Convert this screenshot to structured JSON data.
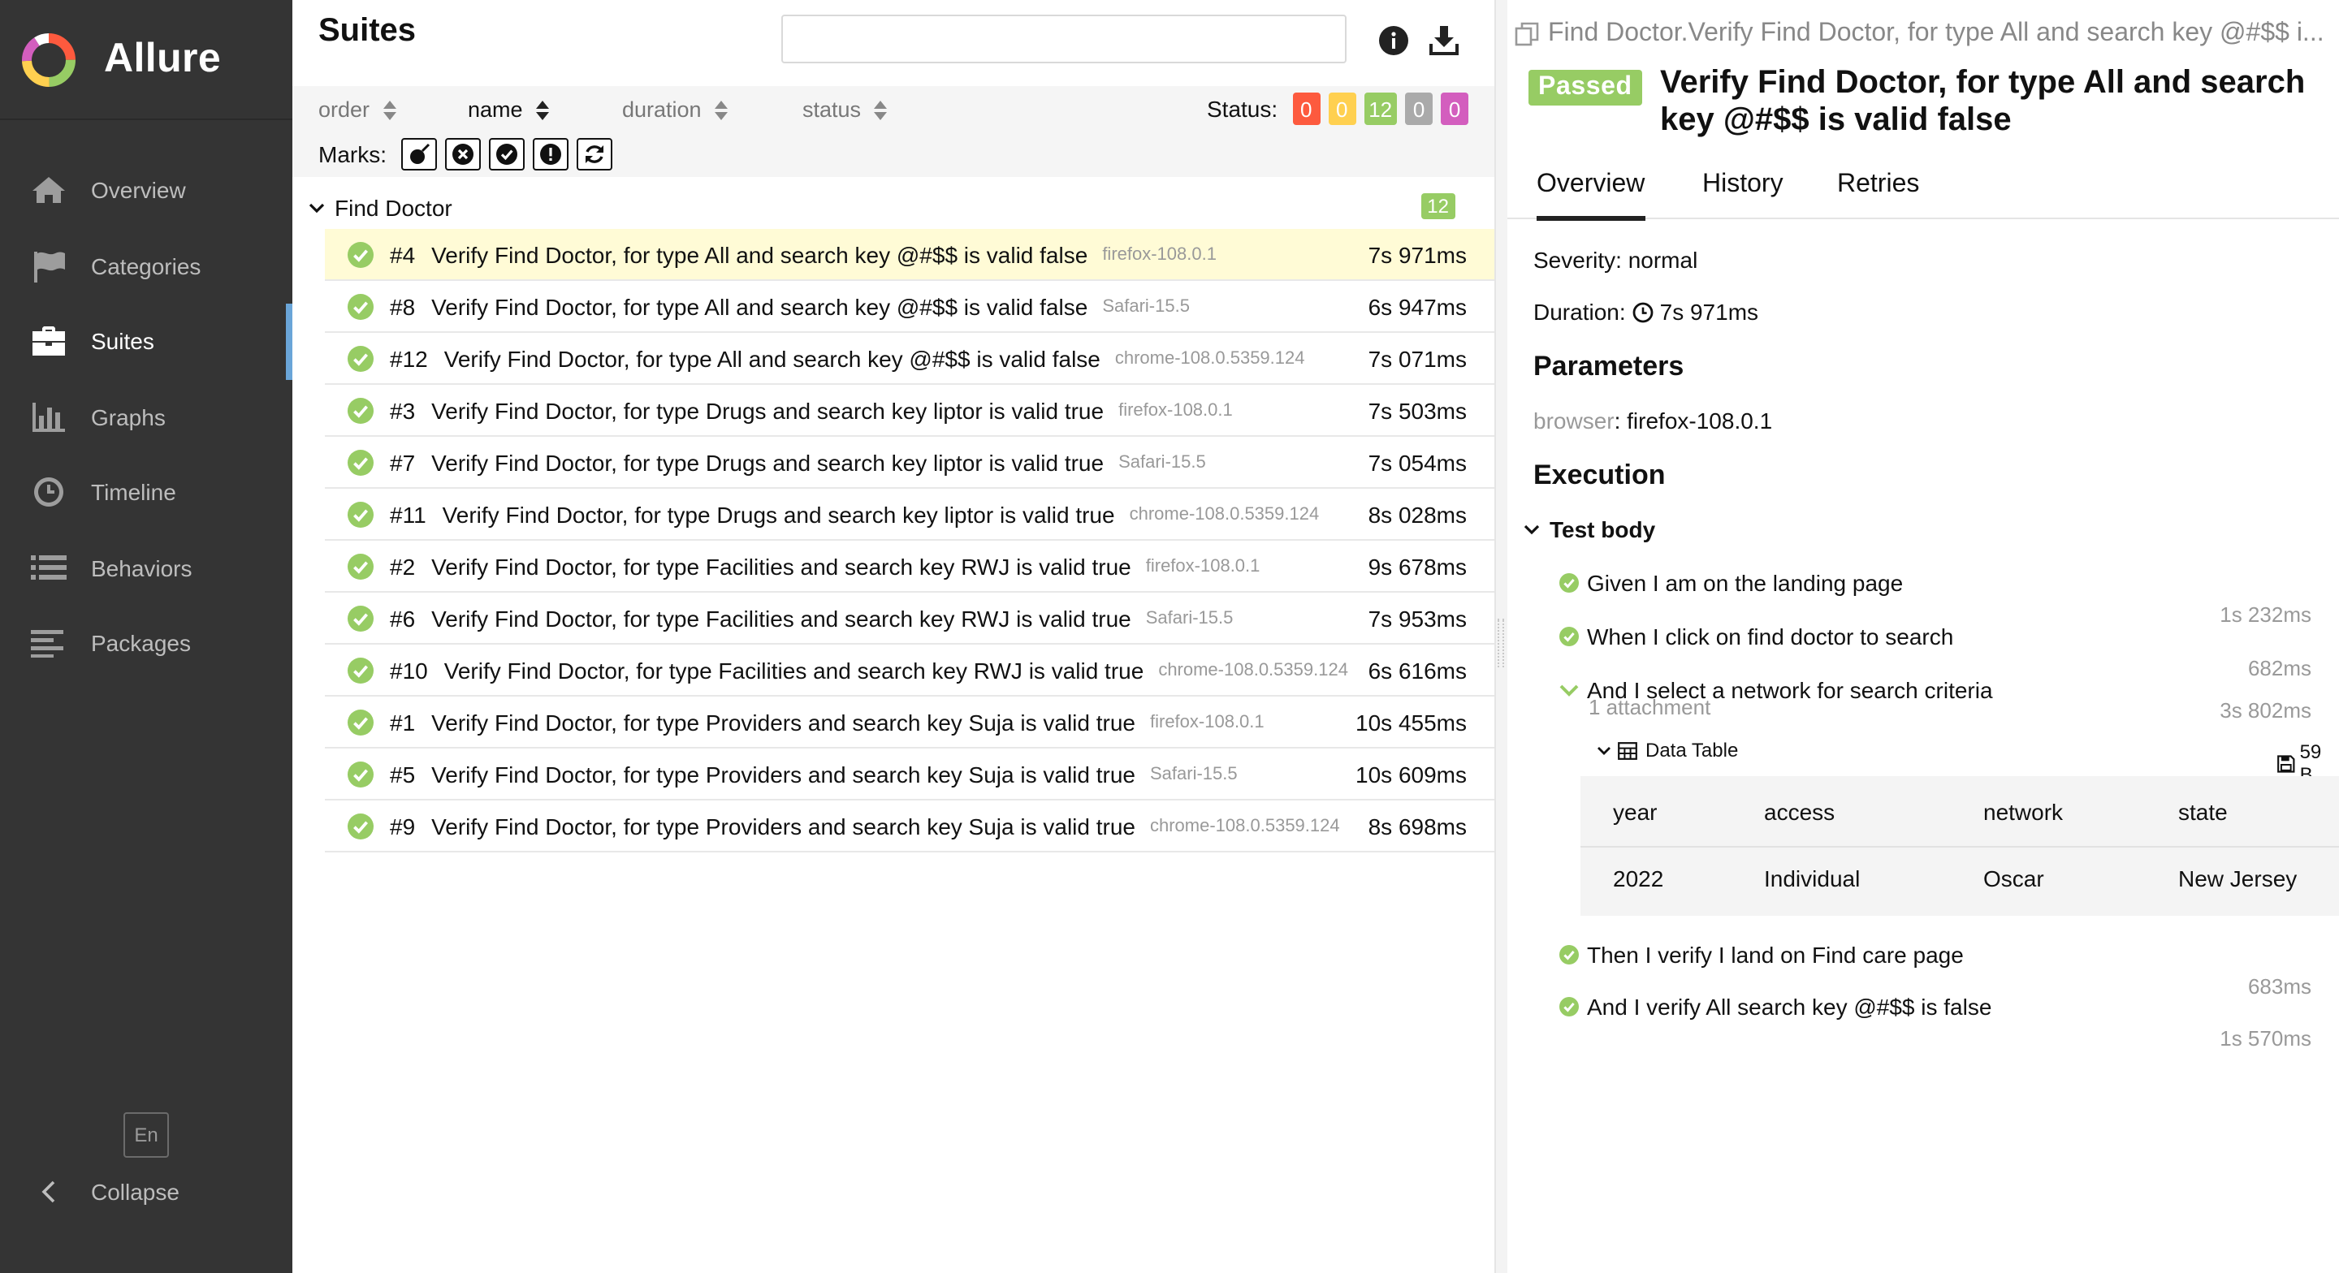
{
  "app": {
    "brand": "Allure"
  },
  "sidebar": {
    "items": [
      {
        "label": "Overview",
        "icon": "home-icon"
      },
      {
        "label": "Categories",
        "icon": "flag-icon"
      },
      {
        "label": "Suites",
        "icon": "briefcase-icon",
        "active": true
      },
      {
        "label": "Graphs",
        "icon": "bar-chart-icon"
      },
      {
        "label": "Timeline",
        "icon": "clock-icon"
      },
      {
        "label": "Behaviors",
        "icon": "list-icon"
      },
      {
        "label": "Packages",
        "icon": "align-left-icon"
      }
    ],
    "lang": "En",
    "collapse": "Collapse"
  },
  "suites": {
    "title": "Suites",
    "search_value": "",
    "sort": {
      "order": "order",
      "name": "name",
      "duration": "duration",
      "status": "status"
    },
    "status_label": "Status:",
    "status_counts": [
      {
        "value": "0",
        "color": "#fd5a3e"
      },
      {
        "value": "0",
        "color": "#ffd050"
      },
      {
        "value": "12",
        "color": "#97cc64"
      },
      {
        "value": "0",
        "color": "#aaaaaa"
      },
      {
        "value": "0",
        "color": "#d35ebe"
      }
    ],
    "marks_label": "Marks:",
    "group": {
      "name": "Find Doctor",
      "count": "12"
    },
    "rows": [
      {
        "uid": "#4",
        "name": "Verify Find Doctor, for type All and search key @#$$ is valid false",
        "param": "firefox-108.0.1",
        "duration": "7s 971ms"
      },
      {
        "uid": "#8",
        "name": "Verify Find Doctor, for type All and search key @#$$ is valid false",
        "param": "Safari-15.5",
        "duration": "6s 947ms"
      },
      {
        "uid": "#12",
        "name": "Verify Find Doctor, for type All and search key @#$$ is valid false",
        "param": "chrome-108.0.5359.124",
        "duration": "7s 071ms"
      },
      {
        "uid": "#3",
        "name": "Verify Find Doctor, for type Drugs and search key liptor is valid true",
        "param": "firefox-108.0.1",
        "duration": "7s 503ms"
      },
      {
        "uid": "#7",
        "name": "Verify Find Doctor, for type Drugs and search key liptor is valid true",
        "param": "Safari-15.5",
        "duration": "7s 054ms"
      },
      {
        "uid": "#11",
        "name": "Verify Find Doctor, for type Drugs and search key liptor is valid true",
        "param": "chrome-108.0.5359.124",
        "duration": "8s 028ms"
      },
      {
        "uid": "#2",
        "name": "Verify Find Doctor, for type Facilities and search key RWJ is valid true",
        "param": "firefox-108.0.1",
        "duration": "9s 678ms"
      },
      {
        "uid": "#6",
        "name": "Verify Find Doctor, for type Facilities and search key RWJ is valid true",
        "param": "Safari-15.5",
        "duration": "7s 953ms"
      },
      {
        "uid": "#10",
        "name": "Verify Find Doctor, for type Facilities and search key RWJ is valid true",
        "param": "chrome-108.0.5359.124",
        "duration": "6s 616ms"
      },
      {
        "uid": "#1",
        "name": "Verify Find Doctor, for type Providers and search key Suja is valid true",
        "param": "firefox-108.0.1",
        "duration": "10s 455ms"
      },
      {
        "uid": "#5",
        "name": "Verify Find Doctor, for type Providers and search key Suja is valid true",
        "param": "Safari-15.5",
        "duration": "10s 609ms"
      },
      {
        "uid": "#9",
        "name": "Verify Find Doctor, for type Providers and search key Suja is valid true",
        "param": "chrome-108.0.5359.124",
        "duration": "8s 698ms"
      }
    ]
  },
  "detail": {
    "breadcrumb": "Find Doctor.Verify Find Doctor, for type All and search key @#$$ i...",
    "status": "Passed",
    "title": "Verify Find Doctor, for type All and search key @#$$ is valid false",
    "tabs": [
      "Overview",
      "History",
      "Retries"
    ],
    "severity": "Severity: normal",
    "duration_label": "Duration:",
    "duration": "7s 971ms",
    "parameters_heading": "Parameters",
    "param_name": "browser",
    "param_value": "firefox-108.0.1",
    "execution_heading": "Execution",
    "test_body": "Test body",
    "steps": [
      {
        "name": "Given I am on the landing page",
        "duration": "1s 232ms"
      },
      {
        "name": "When I click on find doctor to search",
        "duration": "682ms"
      },
      {
        "name": "And I select a network for search criteria",
        "duration": "3s 802ms",
        "attachments": "1 attachment"
      },
      {
        "name": "Then I verify I land on Find care page",
        "duration": "683ms"
      },
      {
        "name": "And I verify All search key @#$$ is false",
        "duration": "1s 570ms"
      }
    ],
    "attachment": {
      "name": "Data Table",
      "size": "59 B",
      "headers": [
        "year",
        "access",
        "network",
        "state"
      ],
      "rows": [
        [
          "2022",
          "Individual",
          "Oscar",
          "New Jersey"
        ]
      ]
    }
  },
  "colors": {
    "passed": "#97cc64",
    "sidebar_bg": "#343434",
    "active_accent": "#6aa5d8"
  }
}
